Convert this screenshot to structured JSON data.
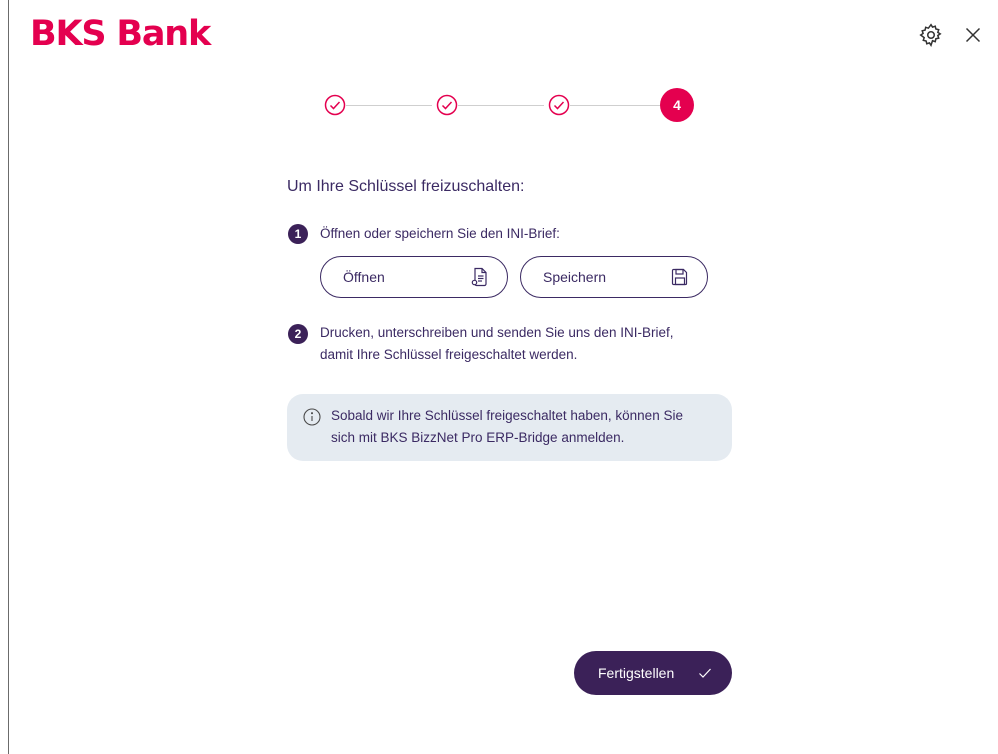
{
  "header": {
    "logo_text": "BKS Bank",
    "settings_icon": "gear-icon",
    "close_icon": "close-icon"
  },
  "stepper": {
    "completed_steps": 3,
    "current_step": "4",
    "accent_color": "#e4004f"
  },
  "content": {
    "heading": "Um Ihre Schlüssel freizuschalten:",
    "steps": [
      {
        "number": "1",
        "text": "Öffnen oder speichern Sie den INI-Brief:"
      },
      {
        "number": "2",
        "line1": "Drucken, unterschreiben und senden Sie uns den INI-Brief,",
        "line2": "damit Ihre Schlüssel freigeschaltet werden."
      }
    ],
    "buttons": {
      "open_label": "Öffnen",
      "open_icon": "document-icon",
      "save_label": "Speichern",
      "save_icon": "floppy-disk-icon"
    },
    "info": {
      "icon": "info-icon",
      "line1": "Sobald wir Ihre Schlüssel freigeschaltet haben, können Sie",
      "line2": "sich mit BKS BizzNet Pro ERP-Bridge anmelden."
    }
  },
  "footer": {
    "finish_label": "Fertigstellen",
    "finish_icon": "checkmark-icon",
    "primary_color": "#3b2158"
  }
}
